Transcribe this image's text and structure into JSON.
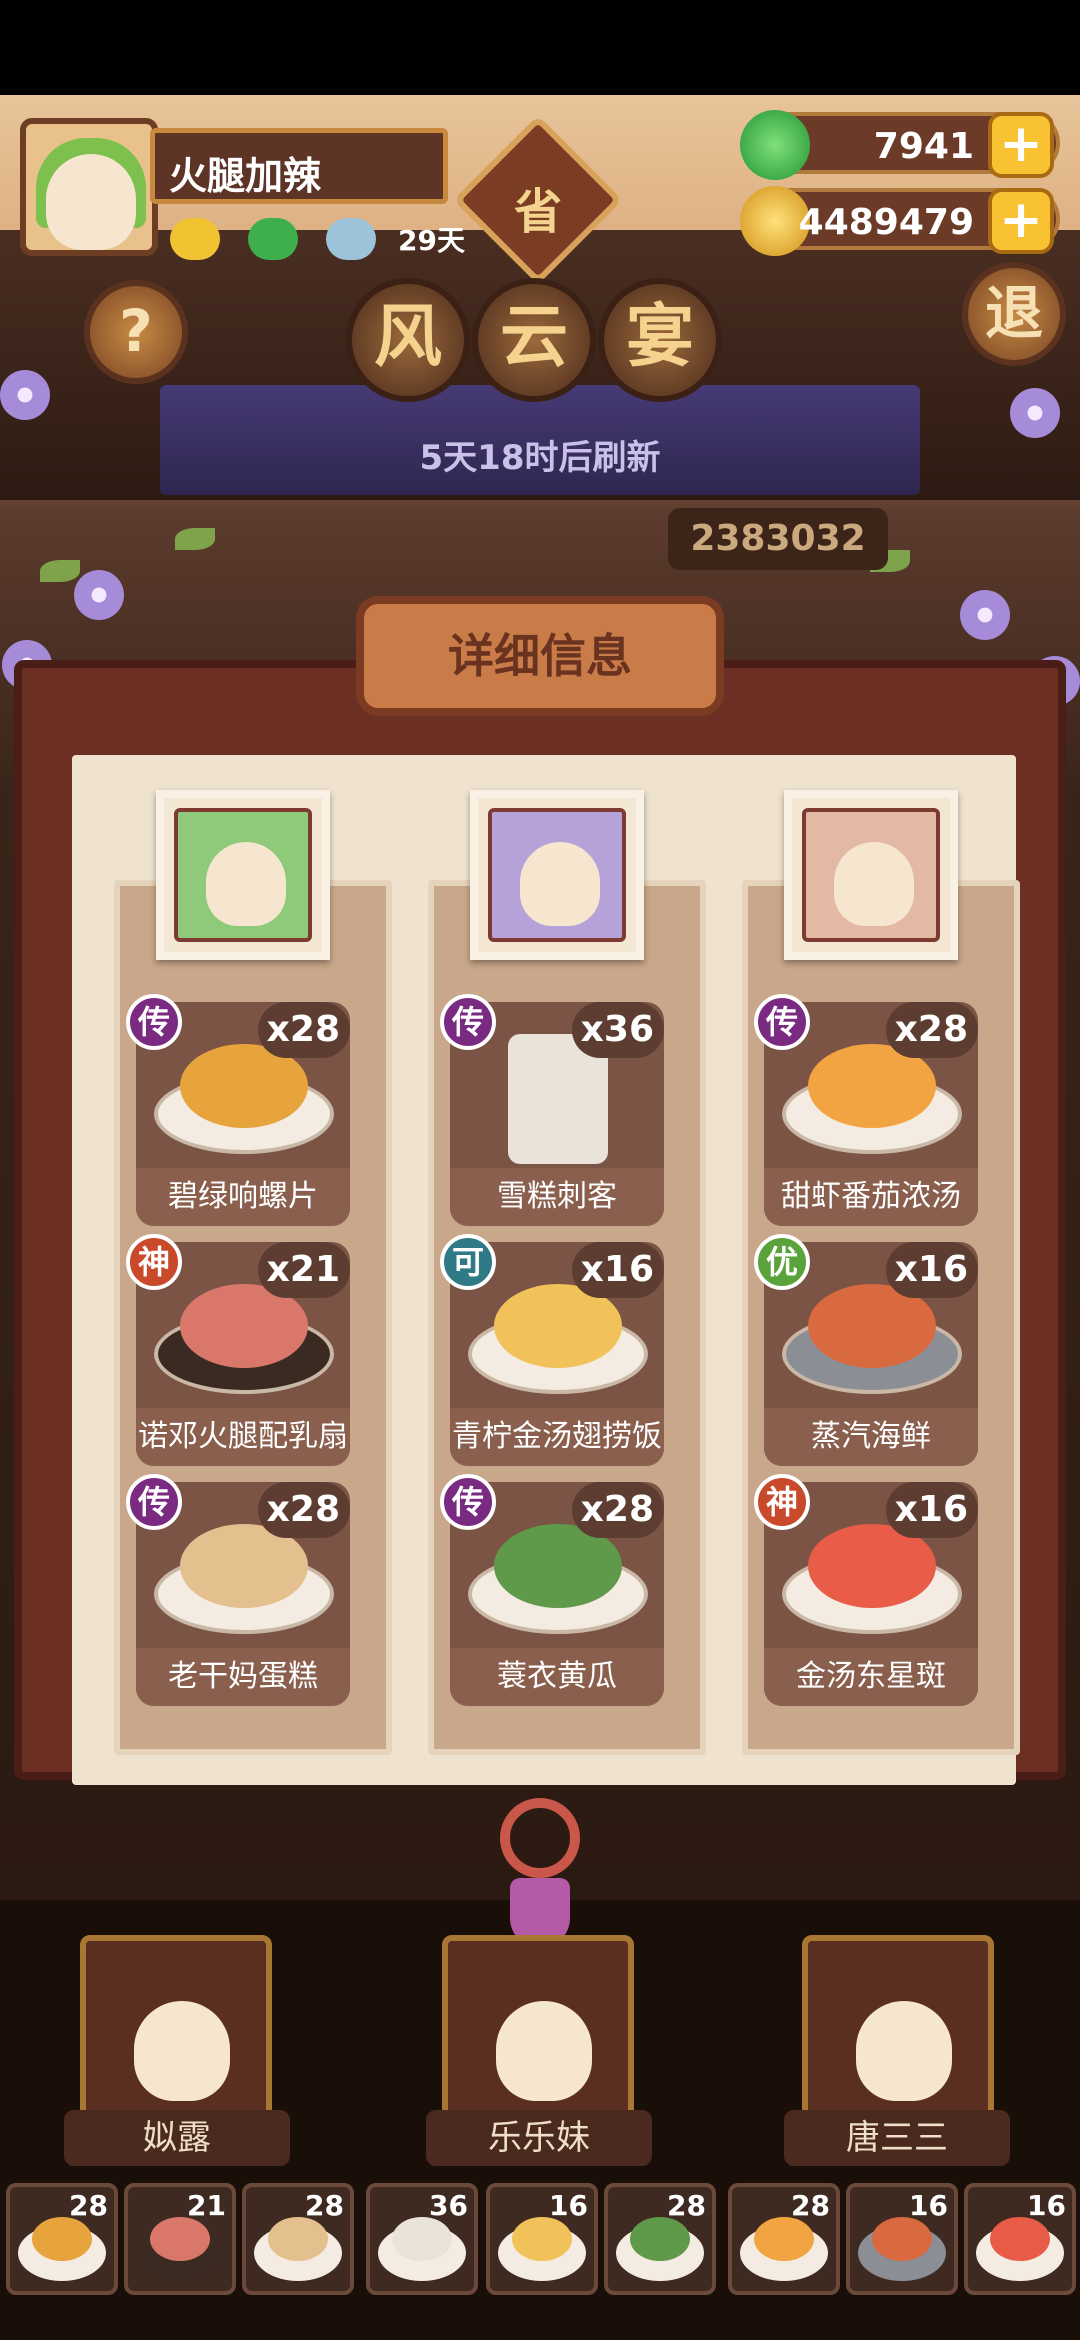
{
  "player": {
    "name": "火腿加辣",
    "days": "29天"
  },
  "province_badge": "省",
  "currency": {
    "jade": {
      "value": "7941",
      "icon": "jade-coin-icon",
      "plus": "+"
    },
    "gold": {
      "value": "4489479",
      "icon": "gold-coin-icon",
      "plus": "+"
    }
  },
  "buttons": {
    "help": "?",
    "exit": "退"
  },
  "title_chars": [
    "风",
    "云",
    "宴"
  ],
  "refresh_text": "5天18时后刷新",
  "score": "2383032",
  "detail_title": "详细信息",
  "columns": [
    {
      "chef": "姒露",
      "dishes": [
        {
          "name": "碧绿响螺片",
          "count": "x28",
          "rarity": "传",
          "rarity_color": "#7b2a82",
          "food_color": "#e7a33c"
        },
        {
          "name": "诺邓火腿配乳扇",
          "count": "x21",
          "rarity": "神",
          "rarity_color": "#c9492b",
          "food_color": "#d9786a"
        },
        {
          "name": "老干妈蛋糕",
          "count": "x28",
          "rarity": "传",
          "rarity_color": "#7b2a82",
          "food_color": "#e5c08f"
        }
      ]
    },
    {
      "chef": "乐乐妹",
      "dishes": [
        {
          "name": "雪糕刺客",
          "count": "x36",
          "rarity": "传",
          "rarity_color": "#7b2a82",
          "food_color": "#e9e3da"
        },
        {
          "name": "青柠金汤翅捞饭",
          "count": "x16",
          "rarity": "可",
          "rarity_color": "#2f7a86",
          "food_color": "#f1c25a"
        },
        {
          "name": "蓑衣黄瓜",
          "count": "x28",
          "rarity": "传",
          "rarity_color": "#7b2a82",
          "food_color": "#5f9a4a"
        }
      ]
    },
    {
      "chef": "唐三三",
      "dishes": [
        {
          "name": "甜虾番茄浓汤",
          "count": "x28",
          "rarity": "传",
          "rarity_color": "#7b2a82",
          "food_color": "#f2a443"
        },
        {
          "name": "蒸汽海鲜",
          "count": "x16",
          "rarity": "优",
          "rarity_color": "#5aa33b",
          "food_color": "#d9693f"
        },
        {
          "name": "金汤东星斑",
          "count": "x16",
          "rarity": "神",
          "rarity_color": "#c9492b",
          "food_color": "#e85c48"
        }
      ]
    }
  ],
  "strip": [
    {
      "count": "28",
      "food_color": "#e7a33c"
    },
    {
      "count": "21",
      "food_color": "#d9786a"
    },
    {
      "count": "28",
      "food_color": "#e5c08f"
    },
    {
      "count": "36",
      "food_color": "#e9e3da"
    },
    {
      "count": "16",
      "food_color": "#f1c25a"
    },
    {
      "count": "28",
      "food_color": "#5f9a4a"
    },
    {
      "count": "28",
      "food_color": "#f2a443"
    },
    {
      "count": "16",
      "food_color": "#d9693f"
    },
    {
      "count": "16",
      "food_color": "#e85c48"
    }
  ]
}
